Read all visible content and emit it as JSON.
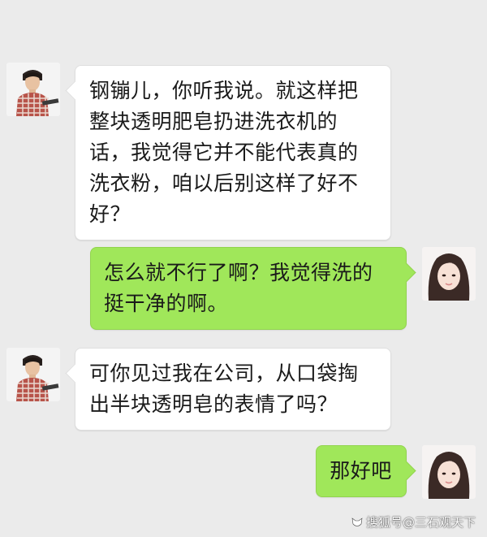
{
  "conversation": {
    "messages": [
      {
        "sender": "male",
        "side": "left",
        "text": "钢镚儿，你听我说。就这样把\n整块透明肥皂扔进洗衣机的\n话，我觉得它并不能代表真的\n洗衣粉，咱以后别这样了好不\n好？"
      },
      {
        "sender": "female",
        "side": "right",
        "text": "怎么就不行了啊？我觉得洗的\n挺干净的啊。"
      },
      {
        "sender": "male",
        "side": "left",
        "text": "可你见过我在公司，从口袋掏\n出半块透明皂的表情了吗？"
      },
      {
        "sender": "female",
        "side": "right",
        "text": "那好吧"
      }
    ]
  },
  "watermark": {
    "text": "搜狐号@三石观天下",
    "icon": "sohu-fox-icon"
  },
  "colors": {
    "background": "#ebebeb",
    "left_bubble": "#ffffff",
    "right_bubble": "#a0e75a",
    "text": "#1a1a1a"
  }
}
